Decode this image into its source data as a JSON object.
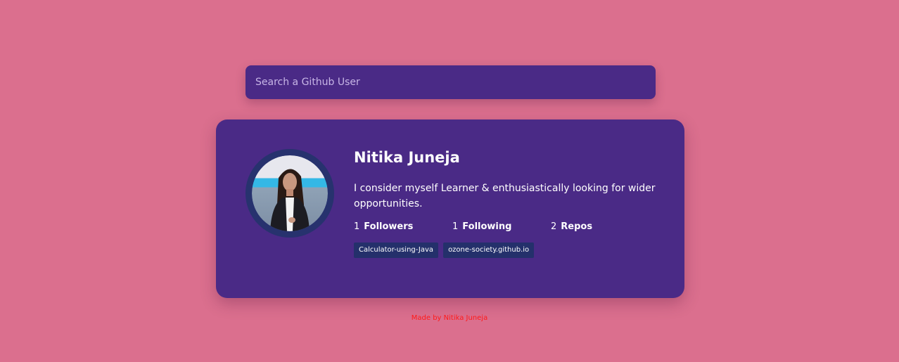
{
  "search": {
    "placeholder": "Search a Github User"
  },
  "profile": {
    "name": "Nitika Juneja",
    "bio": "I consider myself Learner & enthusiastically looking for wider opportunities.",
    "stats": [
      {
        "count": "1",
        "label": "Followers"
      },
      {
        "count": "1",
        "label": "Following"
      },
      {
        "count": "2",
        "label": "Repos"
      }
    ],
    "repos": [
      "Calculator-using-Java",
      "ozone-society.github.io"
    ]
  },
  "footer": {
    "text": "Made by Nitika Juneja"
  },
  "colors": {
    "background": "#db6f8e",
    "card": "#4a2a86",
    "chip": "#24306b",
    "footer_text": "#ff1a1a"
  }
}
